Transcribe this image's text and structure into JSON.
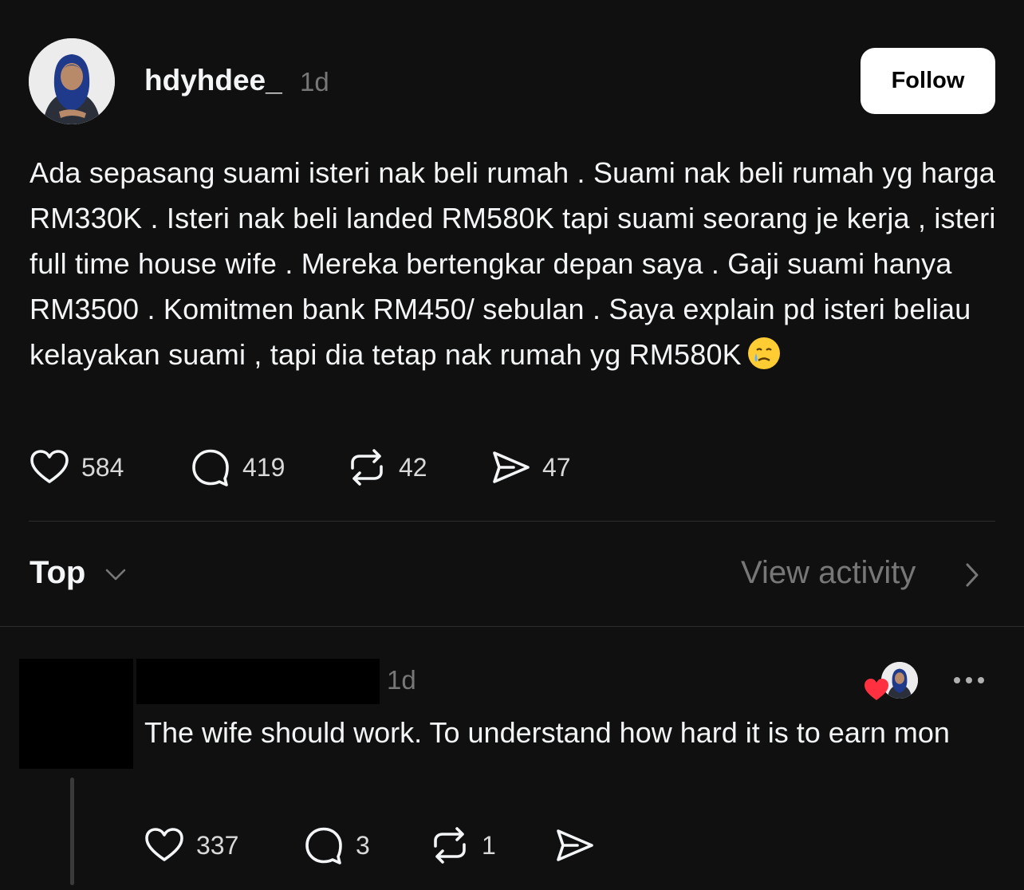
{
  "post": {
    "username": "hdyhdee_",
    "time": "1d",
    "follow_label": "Follow",
    "text": "Ada sepasang suami isteri nak beli rumah . Suami nak beli rumah yg harga RM330K . Isteri nak beli landed RM580K tapi suami seorang je kerja , isteri full time house wife . Mereka bertengkar depan saya . Gaji suami hanya RM3500 . Komitmen bank RM450/ sebulan . Saya explain pd isteri beliau kelayakan suami , tapi dia tetap nak rumah yg RM580K",
    "emoji": "crying-face-emoji",
    "likes": "584",
    "comments": "419",
    "reposts": "42",
    "shares": "47"
  },
  "sort": {
    "label": "Top",
    "view_activity": "View activity"
  },
  "reply": {
    "time": "1d",
    "text": "The wife should work. To understand how hard it is to earn mon",
    "likes": "337",
    "comments": "3",
    "reposts": "1"
  },
  "colors": {
    "background": "#101010",
    "text": "#f3f5f7",
    "muted": "#777777",
    "heart": "#ff3040",
    "hijab": "#1f3a8a"
  },
  "icons": [
    "heart-icon",
    "comment-icon",
    "repost-icon",
    "share-icon",
    "chevron-down-icon",
    "chevron-right-icon",
    "more-icon"
  ]
}
